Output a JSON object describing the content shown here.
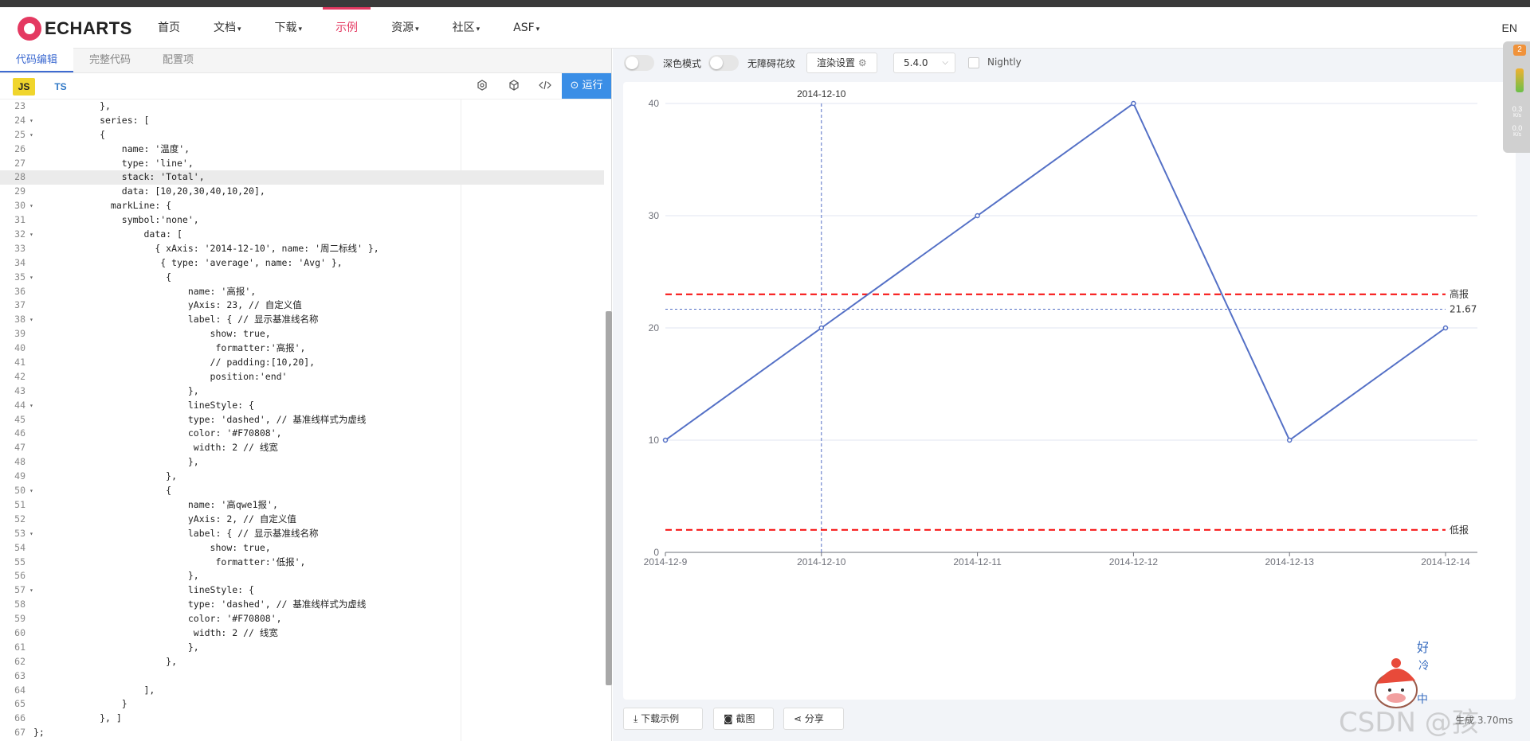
{
  "brand": {
    "name": "ECHARTS",
    "accent": "#e43961"
  },
  "nav": {
    "items": [
      {
        "label": "首页",
        "dropdown": false
      },
      {
        "label": "文档",
        "dropdown": true
      },
      {
        "label": "下载",
        "dropdown": true
      },
      {
        "label": "示例",
        "dropdown": false,
        "active": true
      },
      {
        "label": "资源",
        "dropdown": true
      },
      {
        "label": "社区",
        "dropdown": true
      },
      {
        "label": "ASF",
        "dropdown": true
      }
    ],
    "lang": "EN"
  },
  "editor": {
    "tabs": [
      "代码编辑",
      "完整代码",
      "配置项"
    ],
    "lang_js": "JS",
    "lang_ts": "TS",
    "run_label": "运行",
    "lines": [
      {
        "n": "23",
        "t": "            },"
      },
      {
        "n": "24",
        "t": "            series: [",
        "fold": true
      },
      {
        "n": "25",
        "t": "            {",
        "fold": true
      },
      {
        "n": "26",
        "t": "                name: '温度',"
      },
      {
        "n": "27",
        "t": "                type: 'line',"
      },
      {
        "n": "28",
        "t": "                stack: 'Total',",
        "hl": true
      },
      {
        "n": "29",
        "t": "                data: [10,20,30,40,10,20],"
      },
      {
        "n": "30",
        "t": "              markLine: {",
        "fold": true
      },
      {
        "n": "31",
        "t": "                symbol:'none',"
      },
      {
        "n": "32",
        "t": "                    data: [",
        "fold": true
      },
      {
        "n": "33",
        "t": "                      { xAxis: '2014-12-10', name: '周二标线' },"
      },
      {
        "n": "34",
        "t": "                       { type: 'average', name: 'Avg' },"
      },
      {
        "n": "35",
        "t": "                        {",
        "fold": true
      },
      {
        "n": "36",
        "t": "                            name: '高报',"
      },
      {
        "n": "37",
        "t": "                            yAxis: 23, // 自定义值"
      },
      {
        "n": "38",
        "t": "                            label: { // 显示基准线名称",
        "fold": true
      },
      {
        "n": "39",
        "t": "                                show: true,"
      },
      {
        "n": "40",
        "t": "                                 formatter:'高报',"
      },
      {
        "n": "41",
        "t": "                                // padding:[10,20],"
      },
      {
        "n": "42",
        "t": "                                position:'end'"
      },
      {
        "n": "43",
        "t": "                            },"
      },
      {
        "n": "44",
        "t": "                            lineStyle: {",
        "fold": true
      },
      {
        "n": "45",
        "t": "                            type: 'dashed', // 基准线样式为虚线"
      },
      {
        "n": "46",
        "t": "                            color: '#F70808',"
      },
      {
        "n": "47",
        "t": "                             width: 2 // 线宽"
      },
      {
        "n": "48",
        "t": "                            },"
      },
      {
        "n": "49",
        "t": "                        },"
      },
      {
        "n": "50",
        "t": "                        {",
        "fold": true
      },
      {
        "n": "51",
        "t": "                            name: '高qwe1报',"
      },
      {
        "n": "52",
        "t": "                            yAxis: 2, // 自定义值"
      },
      {
        "n": "53",
        "t": "                            label: { // 显示基准线名称",
        "fold": true
      },
      {
        "n": "54",
        "t": "                                show: true,"
      },
      {
        "n": "55",
        "t": "                                 formatter:'低报',"
      },
      {
        "n": "56",
        "t": "                            },"
      },
      {
        "n": "57",
        "t": "                            lineStyle: {",
        "fold": true
      },
      {
        "n": "58",
        "t": "                            type: 'dashed', // 基准线样式为虚线"
      },
      {
        "n": "59",
        "t": "                            color: '#F70808',"
      },
      {
        "n": "60",
        "t": "                             width: 2 // 线宽"
      },
      {
        "n": "61",
        "t": "                            },"
      },
      {
        "n": "62",
        "t": "                        },"
      },
      {
        "n": "63",
        "t": ""
      },
      {
        "n": "64",
        "t": "                    ],"
      },
      {
        "n": "65",
        "t": "                }"
      },
      {
        "n": "66",
        "t": "            }, ]"
      },
      {
        "n": "67",
        "t": "};"
      }
    ]
  },
  "preview": {
    "dark_mode_label": "深色模式",
    "a11y_label": "无障碍花纹",
    "render_settings_label": "渲染设置",
    "version": "5.4.0",
    "nightly_label": "Nightly",
    "download_label": "下载示例",
    "screenshot_label": "截图",
    "share_label": "分享"
  },
  "side_widget": {
    "badge": "2",
    "up": "0.3",
    "down": "0.0",
    "unit": "K/s"
  },
  "overlay": {
    "watermark": "CSDN @孩",
    "mascot_text": [
      "好",
      "冷",
      "中"
    ],
    "status": "生成 3.70ms"
  },
  "chart_data": {
    "type": "line",
    "categories": [
      "2014-12-9",
      "2014-12-10",
      "2014-12-11",
      "2014-12-12",
      "2014-12-13",
      "2014-12-14"
    ],
    "series": [
      {
        "name": "温度",
        "values": [
          10,
          20,
          30,
          40,
          10,
          20
        ],
        "color": "#5470c6"
      }
    ],
    "ylim": [
      0,
      40
    ],
    "yticks": [
      0,
      10,
      20,
      30,
      40
    ],
    "mark_lines": [
      {
        "type": "vertical",
        "at": "2014-12-10",
        "label": "2014-12-10",
        "color": "#5470c6",
        "style": "dashed"
      },
      {
        "type": "average",
        "value": 21.67,
        "label": "21.67",
        "color": "#5470c6",
        "style": "dashed"
      },
      {
        "type": "horizontal",
        "value": 23,
        "label": "高报",
        "color": "#F70808",
        "style": "dashed"
      },
      {
        "type": "horizontal",
        "value": 2,
        "label": "低报",
        "color": "#F70808",
        "style": "dashed"
      }
    ],
    "grid": true
  }
}
